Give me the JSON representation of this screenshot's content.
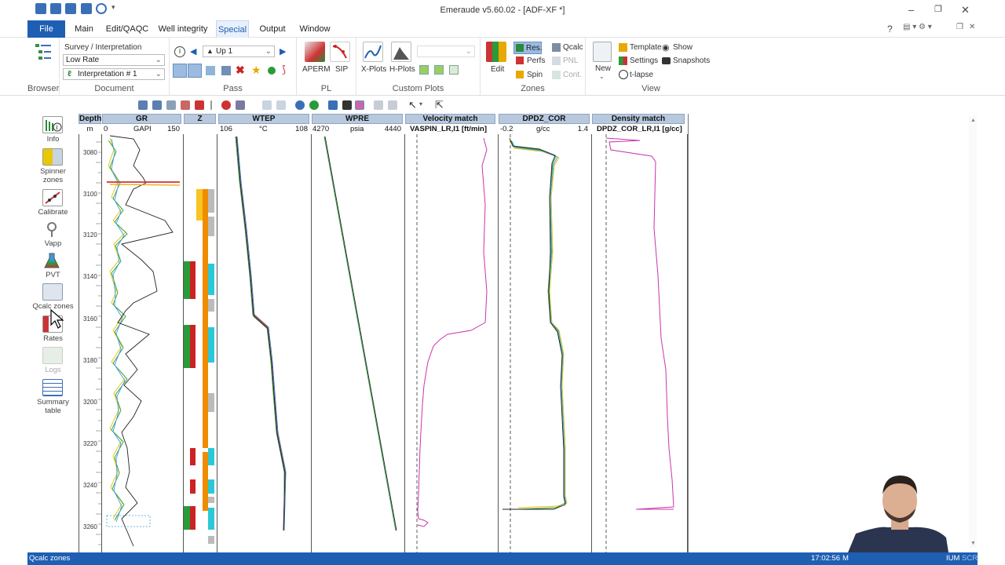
{
  "app": {
    "title": "Emeraude  v5.60.02 - [ADF-XF *]"
  },
  "menu": [
    "File",
    "Main",
    "Edit/QAQC",
    "Well integrity",
    "Special",
    "Output",
    "Window"
  ],
  "ribbon": {
    "browser": "Browser",
    "survey_label": "Survey / Interpretation",
    "survey_value": "Low Rate",
    "interp_value": "Interpretation # 1",
    "document": "Document",
    "pass_value": "Up 1",
    "pass": "Pass",
    "aperm": "APERM",
    "sip": "SIP",
    "pl": "PL",
    "xplots": "X-Plots",
    "hplots": "H-Plots",
    "custom_plots": "Custom Plots",
    "edit": "Edit",
    "res": "Res.",
    "perfs": "Perfs",
    "spin": "Spin",
    "qcalc": "Qcalc",
    "pnl": "PNL",
    "cont": "Cont.",
    "zones": "Zones",
    "new": "New",
    "template": "Template",
    "settings": "Settings",
    "tlapse": "t-lapse",
    "show": "Show",
    "snapshots": "Snapshots",
    "view": "View"
  },
  "left_panel": [
    "Info",
    "Spinner\nzones",
    "Calibrate",
    "Vapp",
    "PVT",
    "Qcalc zones",
    "Rates",
    "Logs",
    "Summary\ntable"
  ],
  "tracks": {
    "depth": {
      "title": "Depth",
      "unit": "m",
      "ticks": [
        "3080",
        "3100",
        "3120",
        "3140",
        "3160",
        "3180",
        "3200",
        "3220",
        "3240",
        "3260"
      ]
    },
    "gr": {
      "title": "GR",
      "min": "0",
      "unit": "GAPI",
      "max": "150"
    },
    "z": {
      "title": "Z"
    },
    "wtep": {
      "title": "WTEP",
      "min": "106",
      "unit": "°C",
      "max": "108"
    },
    "wpre": {
      "title": "WPRE",
      "min": "4270",
      "unit": "psia",
      "max": "4440"
    },
    "vel": {
      "title": "Velocity match",
      "sub": "VASPIN_LR,I1 [ft/min]"
    },
    "dpdz": {
      "title": "DPDZ_COR",
      "min": "-0.2",
      "unit": "g/cc",
      "max": "1.4"
    },
    "dens": {
      "title": "Density match",
      "sub": "DPDZ_COR_LR,I1 [g/cc]"
    }
  },
  "status": {
    "left": "Qcalc zones",
    "time": "17:02:56",
    "mode": "M",
    "right": "IUM",
    "scr": "SCR"
  }
}
